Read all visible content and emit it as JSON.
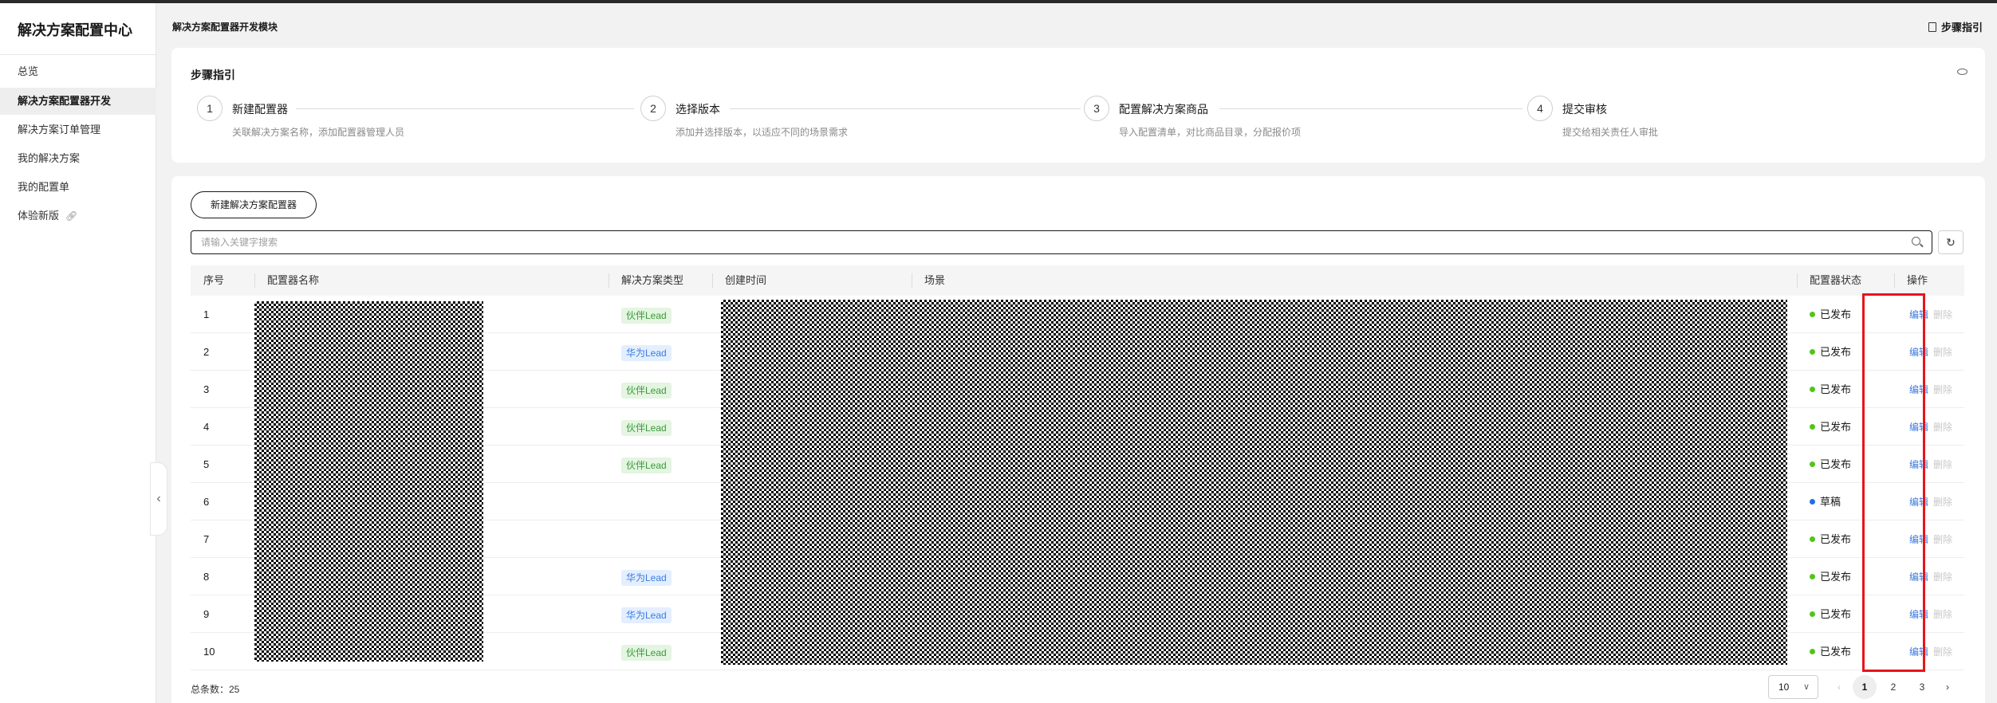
{
  "app": {
    "title": "解决方案配置中心"
  },
  "sidebar": {
    "items": [
      {
        "label": "总览"
      },
      {
        "label": "解决方案配置器开发",
        "active": true
      },
      {
        "label": "解决方案订单管理"
      },
      {
        "label": "我的解决方案"
      },
      {
        "label": "我的配置单"
      },
      {
        "label": "体验新版",
        "icon": "link-icon"
      }
    ]
  },
  "header": {
    "title": "解决方案配置器开发模块",
    "step_guide_label": "步骤指引",
    "step_guide_icon": "document-icon"
  },
  "steps": {
    "title": "步骤指引",
    "toggle_icon": "eye-icon",
    "items": [
      {
        "num": "1",
        "title": "新建配置器",
        "desc": "关联解决方案名称，添加配置器管理人员"
      },
      {
        "num": "2",
        "title": "选择版本",
        "desc": "添加并选择版本，以适应不同的场景需求"
      },
      {
        "num": "3",
        "title": "配置解决方案商品",
        "desc": "导入配置清单，对比商品目录，分配报价项"
      },
      {
        "num": "4",
        "title": "提交审核",
        "desc": "提交给相关责任人审批"
      }
    ]
  },
  "toolbar": {
    "new_button": "新建解决方案配置器",
    "search_placeholder": "请输入关键字搜索",
    "refresh_icon": "refresh-icon"
  },
  "table": {
    "headers": [
      "序号",
      "配置器名称",
      "解决方案类型",
      "创建时间",
      "场景",
      "配置器状态",
      "操作"
    ],
    "rows": [
      {
        "no": "1",
        "type": "伙伴Lead",
        "type_kind": "partner",
        "status": "已发布",
        "status_color": "#52c41a",
        "edit": "编辑",
        "delete": "删除"
      },
      {
        "no": "2",
        "type": "华为Lead",
        "type_kind": "huawei",
        "status": "已发布",
        "status_color": "#52c41a",
        "edit": "编辑",
        "delete": "删除"
      },
      {
        "no": "3",
        "type": "伙伴Lead",
        "type_kind": "partner",
        "status": "已发布",
        "status_color": "#52c41a",
        "edit": "编辑",
        "delete": "删除"
      },
      {
        "no": "4",
        "type": "伙伴Lead",
        "type_kind": "partner",
        "status": "已发布",
        "status_color": "#52c41a",
        "edit": "编辑",
        "delete": "删除"
      },
      {
        "no": "5",
        "type": "伙伴Lead",
        "type_kind": "partner",
        "status": "已发布",
        "status_color": "#52c41a",
        "edit": "编辑",
        "delete": "删除"
      },
      {
        "no": "6",
        "type": "",
        "type_kind": "",
        "status": "草稿",
        "status_color": "#1f6fe5",
        "edit": "编辑",
        "delete": "删除"
      },
      {
        "no": "7",
        "type": "",
        "type_kind": "",
        "status": "已发布",
        "status_color": "#52c41a",
        "edit": "编辑",
        "delete": "删除"
      },
      {
        "no": "8",
        "type": "华为Lead",
        "type_kind": "huawei",
        "status": "已发布",
        "status_color": "#52c41a",
        "edit": "编辑",
        "delete": "删除"
      },
      {
        "no": "9",
        "type": "华为Lead",
        "type_kind": "huawei",
        "status": "已发布",
        "status_color": "#52c41a",
        "edit": "编辑",
        "delete": "删除"
      },
      {
        "no": "10",
        "type": "伙伴Lead",
        "type_kind": "partner",
        "status": "已发布",
        "status_color": "#52c41a",
        "edit": "编辑",
        "delete": "删除"
      }
    ]
  },
  "footer": {
    "total": "总条数：25",
    "page_size": "10",
    "pages": [
      "1",
      "2",
      "3"
    ],
    "current_page": "1"
  },
  "colors": {
    "accent": "#3b7be0",
    "published": "#52c41a",
    "draft": "#1f6fe5",
    "highlight": "#e8141c"
  }
}
